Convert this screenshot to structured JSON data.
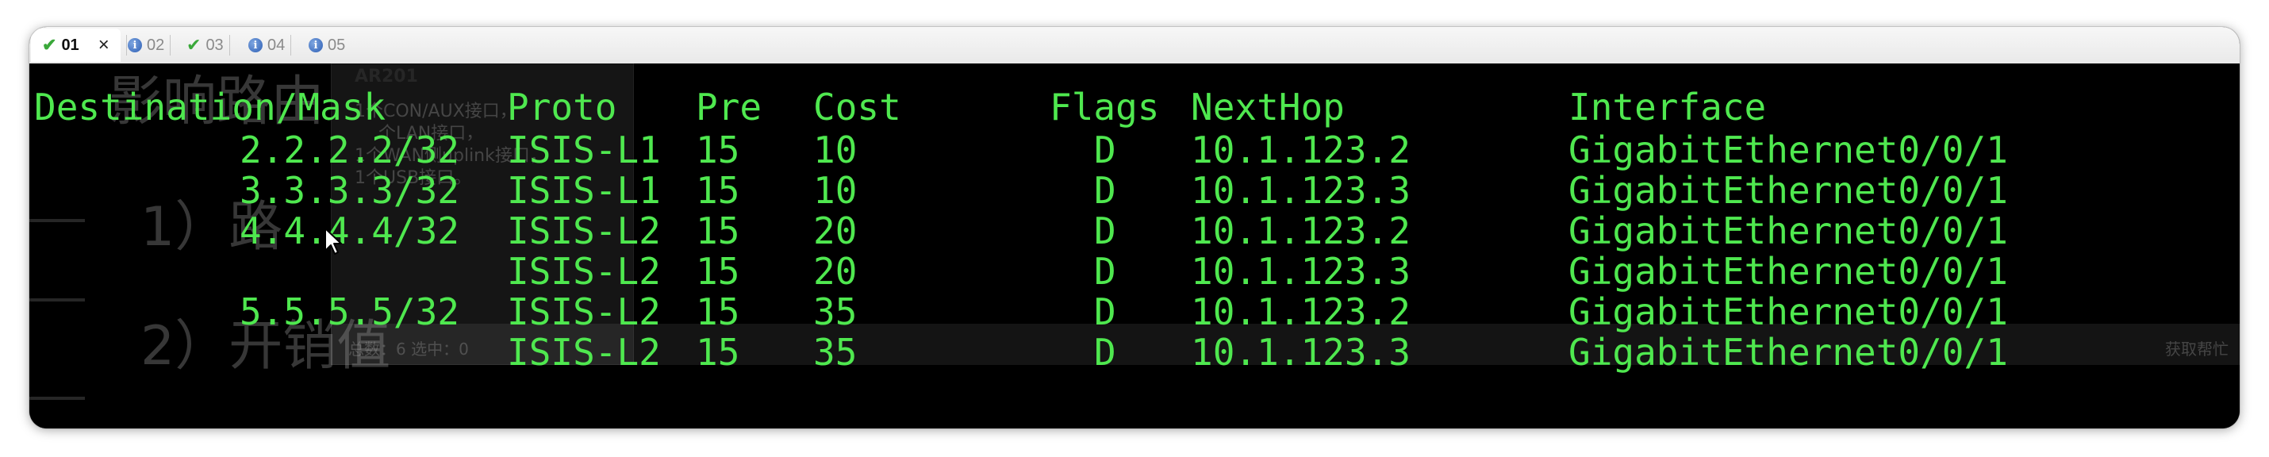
{
  "tabs": [
    {
      "label": "01",
      "icon": "check-icon",
      "active": true
    },
    {
      "label": "02",
      "icon": "info-icon",
      "active": false
    },
    {
      "label": "03",
      "icon": "check-icon",
      "active": false
    },
    {
      "label": "04",
      "icon": "info-icon",
      "active": false
    },
    {
      "label": "05",
      "icon": "info-icon",
      "active": false
    }
  ],
  "close_glyph": "×",
  "background_window": {
    "title": "AR201",
    "lines": [
      "1个CON/AUX接口，",
      "个LAN接口，",
      "1个WAN侧uplink接口，",
      "1个USB接口。"
    ],
    "heading": "影响路由",
    "item1": "1）路",
    "item2": "2）开销值",
    "status": "总数：6  选中：0",
    "button": "获取帮忙"
  },
  "table": {
    "headers": {
      "destination": "Destination/Mask",
      "proto": "Proto",
      "pre": "Pre",
      "cost": "Cost",
      "flags": "Flags",
      "nexthop": "NextHop",
      "interface": "Interface"
    },
    "rows": [
      {
        "destination": "2.2.2.2/32",
        "proto": "ISIS-L1",
        "pre": "15",
        "cost": "10",
        "flags": "D",
        "nexthop": "10.1.123.2",
        "interface": "GigabitEthernet0/0/1"
      },
      {
        "destination": "3.3.3.3/32",
        "proto": "ISIS-L1",
        "pre": "15",
        "cost": "10",
        "flags": "D",
        "nexthop": "10.1.123.3",
        "interface": "GigabitEthernet0/0/1"
      },
      {
        "destination": "4.4.4.4/32",
        "proto": "ISIS-L2",
        "pre": "15",
        "cost": "20",
        "flags": "D",
        "nexthop": "10.1.123.2",
        "interface": "GigabitEthernet0/0/1"
      },
      {
        "destination": "",
        "proto": "ISIS-L2",
        "pre": "15",
        "cost": "20",
        "flags": "D",
        "nexthop": "10.1.123.3",
        "interface": "GigabitEthernet0/0/1"
      },
      {
        "destination": "5.5.5.5/32",
        "proto": "ISIS-L2",
        "pre": "15",
        "cost": "35",
        "flags": "D",
        "nexthop": "10.1.123.2",
        "interface": "GigabitEthernet0/0/1"
      },
      {
        "destination": "",
        "proto": "ISIS-L2",
        "pre": "15",
        "cost": "35",
        "flags": "D",
        "nexthop": "10.1.123.3",
        "interface": "GigabitEthernet0/0/1"
      }
    ]
  },
  "colors": {
    "terminal_text": "#4fe84f",
    "terminal_bg": "#000000",
    "check": "#3aa83a",
    "info": "#2d5fb5"
  }
}
